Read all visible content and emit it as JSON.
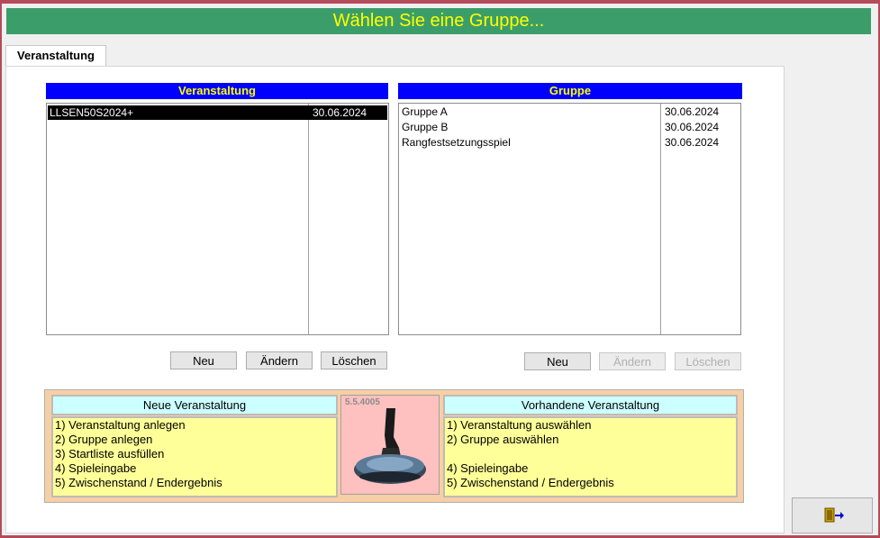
{
  "title": "Wählen Sie eine Gruppe...",
  "tab": {
    "label": "Veranstaltung"
  },
  "events": {
    "header": "Veranstaltung",
    "rows": [
      {
        "name": "LLSEN50S2024+",
        "date": "30.06.2024",
        "selected": true
      }
    ],
    "buttons": {
      "new": "Neu",
      "edit": "Ändern",
      "delete": "Löschen"
    }
  },
  "groups": {
    "header": "Gruppe",
    "rows": [
      {
        "name": "Gruppe A",
        "date": "30.06.2024"
      },
      {
        "name": "Gruppe B",
        "date": "30.06.2024"
      },
      {
        "name": "Rangfestsetzungsspiel",
        "date": "30.06.2024"
      }
    ],
    "buttons": {
      "new": "Neu",
      "edit": "Ändern",
      "delete": "Löschen"
    },
    "disabled": [
      "edit",
      "delete"
    ]
  },
  "info": {
    "new_title": "Neue Veranstaltung",
    "new_steps": [
      "1) Veranstaltung anlegen",
      "2) Gruppe anlegen",
      "3) Startliste ausfüllen",
      "4) Spieleingabe",
      "5) Zwischenstand / Endergebnis"
    ],
    "existing_title": "Vorhandene Veranstaltung",
    "existing_steps": [
      "1) Veranstaltung auswählen",
      "2) Gruppe auswählen",
      "",
      "4) Spieleingabe",
      "5) Zwischenstand / Endergebnis"
    ],
    "version": "5.5.4005"
  },
  "colors": {
    "title_bg": "#3b9e6a",
    "title_text": "#ffff00",
    "list_header_bg": "#0000ff",
    "info_panel_bg": "#f7cfa4",
    "info_box_bg": "#ffff99",
    "info_title_bg": "#ccffff"
  },
  "icons": {
    "exit": "exit-door-icon",
    "logo": "curling-stone-icon"
  }
}
